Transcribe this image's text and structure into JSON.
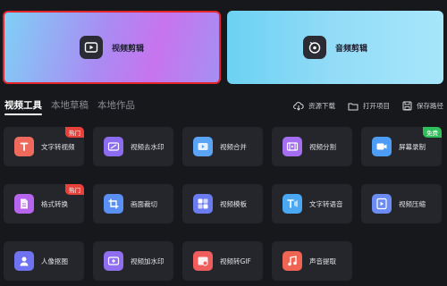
{
  "hero": {
    "video_label": "视频剪辑",
    "audio_label": "音频剪辑"
  },
  "tabs": [
    {
      "label": "视频工具",
      "active": true
    },
    {
      "label": "本地草稿",
      "active": false
    },
    {
      "label": "本地作品",
      "active": false
    }
  ],
  "actions": [
    {
      "label": "资源下载",
      "icon": "cloud-download-icon"
    },
    {
      "label": "打开项目",
      "icon": "folder-icon"
    },
    {
      "label": "保存路径",
      "icon": "save-icon"
    }
  ],
  "tools": [
    {
      "label": "文字转视频",
      "icon": "text-to-video-icon",
      "color": "#ef6a5c",
      "badge": "热门"
    },
    {
      "label": "视频去水印",
      "icon": "remove-watermark-icon",
      "color": "#8c6cf0",
      "badge": ""
    },
    {
      "label": "视频合并",
      "icon": "merge-video-icon",
      "color": "#5aa3f5",
      "badge": ""
    },
    {
      "label": "视频分割",
      "icon": "split-video-icon",
      "color": "#a36ef0",
      "badge": ""
    },
    {
      "label": "屏幕录制",
      "icon": "screen-record-icon",
      "color": "#4d9cf5",
      "badge": "免费"
    },
    {
      "label": "格式转换",
      "icon": "format-convert-icon",
      "color": "#b765ef",
      "badge": "热门"
    },
    {
      "label": "画面裁切",
      "icon": "crop-icon",
      "color": "#5a8ff5",
      "badge": ""
    },
    {
      "label": "视频模板",
      "icon": "template-icon",
      "color": "#6b7bf0",
      "badge": ""
    },
    {
      "label": "文字转语音",
      "icon": "text-to-speech-icon",
      "color": "#4aa7f2",
      "badge": ""
    },
    {
      "label": "视频压缩",
      "icon": "compress-video-icon",
      "color": "#6c8cf3",
      "badge": ""
    },
    {
      "label": "人像抠图",
      "icon": "portrait-cutout-icon",
      "color": "#6f73f2",
      "badge": ""
    },
    {
      "label": "视频加水印",
      "icon": "add-watermark-icon",
      "color": "#8f6ff0",
      "badge": ""
    },
    {
      "label": "视频转GIF",
      "icon": "video-to-gif-icon",
      "color": "#ef5d5d",
      "badge": ""
    },
    {
      "label": "声音提取",
      "icon": "audio-extract-icon",
      "color": "#ef6452",
      "badge": ""
    }
  ]
}
